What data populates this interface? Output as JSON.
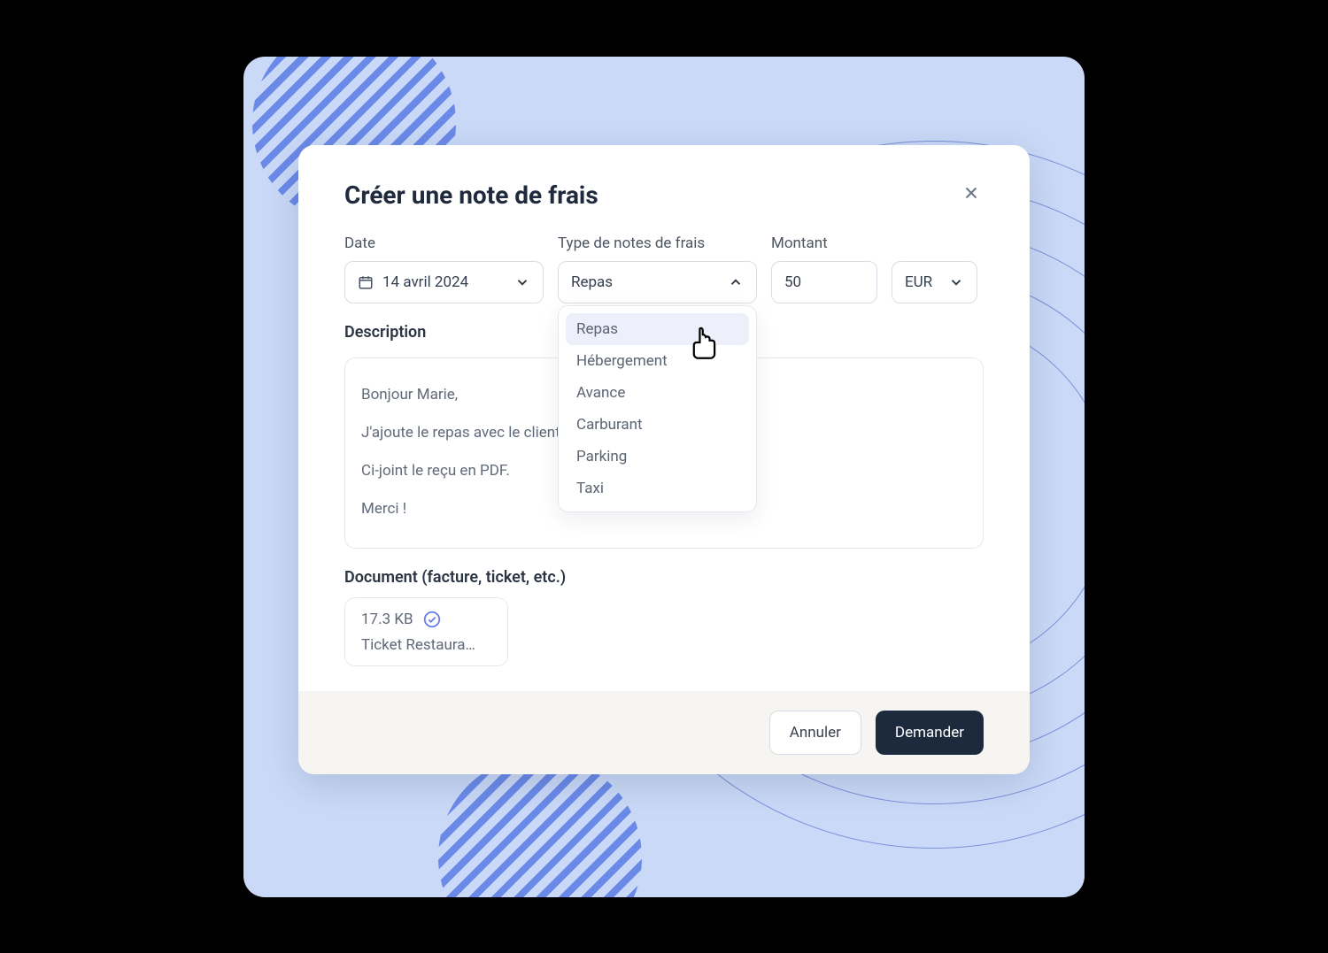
{
  "modal": {
    "title": "Créer une note de frais",
    "date_label": "Date",
    "date_value": "14 avril 2024",
    "type_label": "Type de notes de frais",
    "type_value": "Repas",
    "type_options": [
      "Repas",
      "Hébergement",
      "Avance",
      "Carburant",
      "Parking",
      "Taxi"
    ],
    "amount_label": "Montant",
    "amount_value": "50",
    "currency_value": "EUR",
    "description_label": "Description",
    "description_lines": [
      "Bonjour Marie,",
      "J'ajoute le repas avec le client",
      "Ci-joint le reçu en PDF.",
      "Merci !"
    ],
    "document_label": "Document (facture, ticket, etc.)",
    "file_size": "17.3 KB",
    "file_name": "Ticket Restaura…",
    "cancel_label": "Annuler",
    "submit_label": "Demander"
  }
}
